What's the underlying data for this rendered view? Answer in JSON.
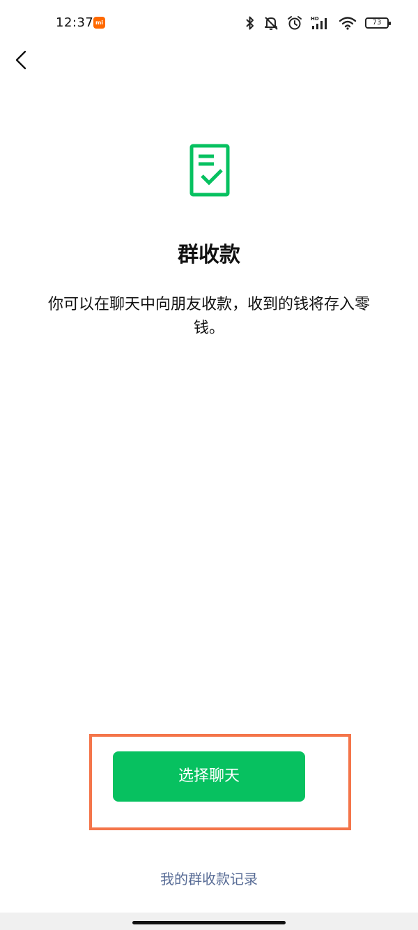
{
  "status_bar": {
    "time": "12:37",
    "battery": "73",
    "icons": [
      "mi-app-icon",
      "bluetooth-icon",
      "mute-icon",
      "alarm-icon",
      "hd-signal-icon",
      "wifi-icon",
      "battery-icon"
    ]
  },
  "nav": {
    "back_icon": "chevron-left-icon"
  },
  "main": {
    "icon": "document-check-icon",
    "title": "群收款",
    "description": "你可以在聊天中向朋友收款，收到的钱将存入零钱。",
    "primary_button": "选择聊天",
    "records_link": "我的群收款记录"
  },
  "colors": {
    "accent": "#07c160",
    "link": "#576b95",
    "highlight": "#f4754a",
    "background": "#ffffff"
  }
}
